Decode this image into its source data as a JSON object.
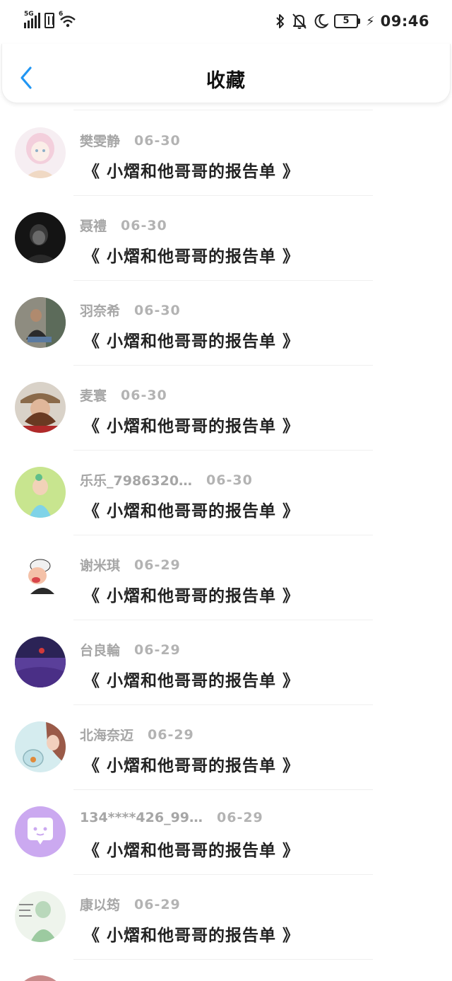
{
  "status_bar": {
    "network": "5G",
    "wifi_tag": "6",
    "battery_level": "5",
    "time": "09:46",
    "icons": [
      "signal-icon",
      "sim-icon",
      "wifi-icon",
      "bluetooth-icon",
      "mute-bell-icon",
      "moon-icon",
      "battery-icon",
      "charging-icon"
    ]
  },
  "header": {
    "title": "收藏",
    "back_icon": "chevron-left-icon",
    "accent": "#2196f3"
  },
  "items": [
    {
      "name": "樊雯静",
      "date": "06-30",
      "title": "《 小熠和他哥哥的报告单 》",
      "avatar_color": "#f3dfe6"
    },
    {
      "name": "聂禮",
      "date": "06-30",
      "title": "《 小熠和他哥哥的报告单 》",
      "avatar_color": "#1c1c1c"
    },
    {
      "name": "羽奈希",
      "date": "06-30",
      "title": "《 小熠和他哥哥的报告单 》",
      "avatar_color": "#6b6b60"
    },
    {
      "name": "麦寰",
      "date": "06-30",
      "title": "《 小熠和他哥哥的报告单 》",
      "avatar_color": "#8a4a32"
    },
    {
      "name": "乐乐_79863​20…",
      "date": "06-30",
      "title": "《 小熠和他哥哥的报告单 》",
      "avatar_color": "#bfe08c"
    },
    {
      "name": "谢米琪",
      "date": "06-29",
      "title": "《 小熠和他哥哥的报告单 》",
      "avatar_color": "#ffffff"
    },
    {
      "name": "台良輪",
      "date": "06-29",
      "title": "《 小熠和他哥哥的报告单 》",
      "avatar_color": "#3b2e6e"
    },
    {
      "name": "北海奈迈",
      "date": "06-29",
      "title": "《 小熠和他哥哥的报告单 》",
      "avatar_color": "#cfe6e9"
    },
    {
      "name": "134****426_99…",
      "date": "06-29",
      "title": "《 小熠和他哥哥的报告单 》",
      "avatar_color": "#c9a7ef"
    },
    {
      "name": "康以筠",
      "date": "06-29",
      "title": "《 小熠和他哥哥的报告单 》",
      "avatar_color": "#d7e8d6"
    }
  ]
}
